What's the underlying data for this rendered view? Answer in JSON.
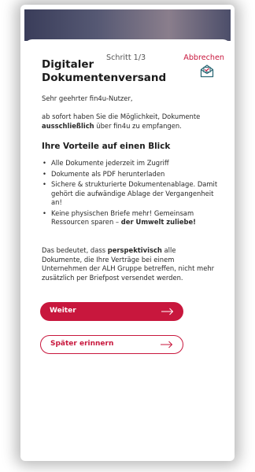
{
  "header": {
    "step": "Schritt 1/3",
    "cancel": "Abbrechen"
  },
  "title": "Digitaler Dokumentenversand",
  "greeting": "Sehr geehrter fin4u-Nutzer,",
  "intro": {
    "pre": "ab sofort haben Sie die Möglichkeit, Dokumente ",
    "bold": "ausschließlich",
    "post": " über fin4u zu empfangen."
  },
  "benefits_heading": "Ihre Vorteile auf einen Blick",
  "benefits": [
    {
      "text": "Alle Dokumente jederzeit im Zugriff",
      "bold": ""
    },
    {
      "text": "Dokumente als PDF herunterladen",
      "bold": ""
    },
    {
      "text": "Sichere & strukturierte Dokumentenablage. Damit gehört die aufwändige Ablage der Vergangenheit an!",
      "bold": ""
    },
    {
      "text": "Keine physischen Briefe mehr! Gemeinsam Ressourcen sparen – ",
      "bold": "der Umwelt zuliebe!"
    }
  ],
  "outro": {
    "pre": "Das bedeutet, dass ",
    "bold": "perspektivisch",
    "post": " alle Dokumente, die Ihre Verträge bei einem Unternehmen der ALH Gruppe betreffen, nicht mehr zusätzlich per Briefpost versendet werden."
  },
  "buttons": {
    "primary": "Weiter",
    "secondary": "Später erinnern"
  },
  "icons": {
    "document": "mail-document-icon",
    "arrow": "arrow-right-icon"
  },
  "colors": {
    "accent": "#c8173d",
    "text": "#1c1c1c"
  }
}
